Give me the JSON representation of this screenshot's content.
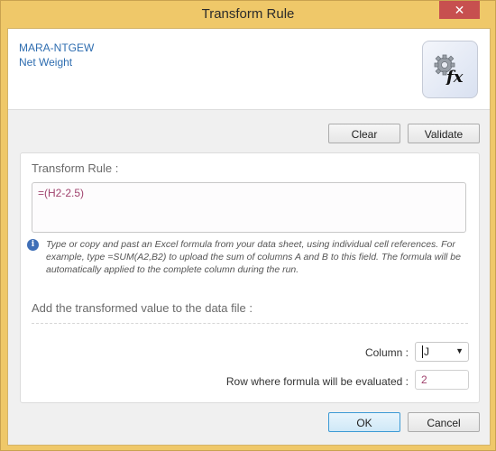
{
  "window": {
    "title": "Transform Rule",
    "close_label": "✕"
  },
  "header": {
    "field_code": "MARA-NTGEW",
    "field_name": "Net Weight",
    "icon": "gear-fx-icon"
  },
  "toolbar": {
    "clear_label": "Clear",
    "validate_label": "Validate"
  },
  "rule": {
    "title": "Transform Rule :",
    "formula": "=(H2-2.5)",
    "info_icon": "info-icon",
    "info_text": "Type or copy and past an Excel formula from your data sheet, using individual cell references. For example, type =SUM(A2,B2) to upload the sum of columns A and B to this field. The formula will be automatically applied to the complete column during the run."
  },
  "target": {
    "title": "Add the transformed value to the data file :",
    "column_label": "Column :",
    "column_value": "J",
    "row_label": "Row where formula will be evaluated :",
    "row_value": "2"
  },
  "footer": {
    "ok_label": "OK",
    "cancel_label": "Cancel"
  }
}
